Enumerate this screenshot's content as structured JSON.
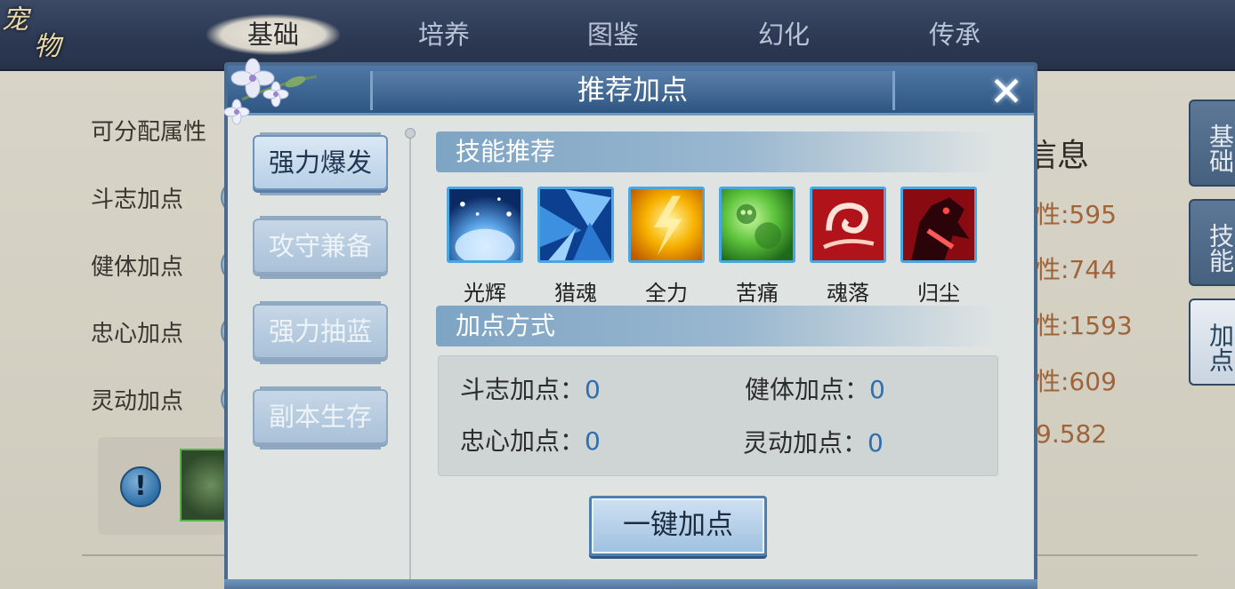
{
  "logo": {
    "line1": "宠",
    "line2": "物"
  },
  "top_tabs": [
    {
      "label": "基础",
      "active": true
    },
    {
      "label": "培养",
      "active": false
    },
    {
      "label": "图鉴",
      "active": false
    },
    {
      "label": "幻化",
      "active": false
    },
    {
      "label": "传承",
      "active": false
    }
  ],
  "background": {
    "attr_title": "可分配属性",
    "left_labels": [
      "斗志加点",
      "健体加点",
      "忠心加点",
      "灵动加点"
    ],
    "info_heading": "信息",
    "stats": [
      "性:595",
      "性:744",
      "性:1593",
      "性:609",
      "9.582"
    ],
    "side_tabs": [
      {
        "label": "基础",
        "active": false
      },
      {
        "label": "技能",
        "active": false
      },
      {
        "label": "加点",
        "active": true
      }
    ],
    "info_icon": "!"
  },
  "dialog": {
    "title": "推荐加点",
    "close_icon": "✕",
    "categories": [
      {
        "label": "强力爆发",
        "active": true
      },
      {
        "label": "攻守兼备",
        "active": false
      },
      {
        "label": "强力抽蓝",
        "active": false
      },
      {
        "label": "副本生存",
        "active": false
      }
    ],
    "skills_header": "技能推荐",
    "skills": [
      {
        "name": "光辉",
        "icon": "radiance-icon",
        "color": "#1a6fc0"
      },
      {
        "name": "猎魂",
        "icon": "soul-hunt-icon",
        "color": "#2b7bd0"
      },
      {
        "name": "全力",
        "icon": "full-power-icon",
        "color": "#f0a800"
      },
      {
        "name": "苦痛",
        "icon": "agony-icon",
        "color": "#4fb33a"
      },
      {
        "name": "魂落",
        "icon": "soul-fall-icon",
        "color": "#c81e1e"
      },
      {
        "name": "归尘",
        "icon": "return-dust-icon",
        "color": "#a00c14"
      }
    ],
    "allocation_header": "加点方式",
    "allocations": [
      {
        "label": "斗志加点：",
        "value": "0"
      },
      {
        "label": "健体加点：",
        "value": "0"
      },
      {
        "label": "忠心加点：",
        "value": "0"
      },
      {
        "label": "灵动加点：",
        "value": "0"
      }
    ],
    "one_click_label": "一键加点"
  }
}
